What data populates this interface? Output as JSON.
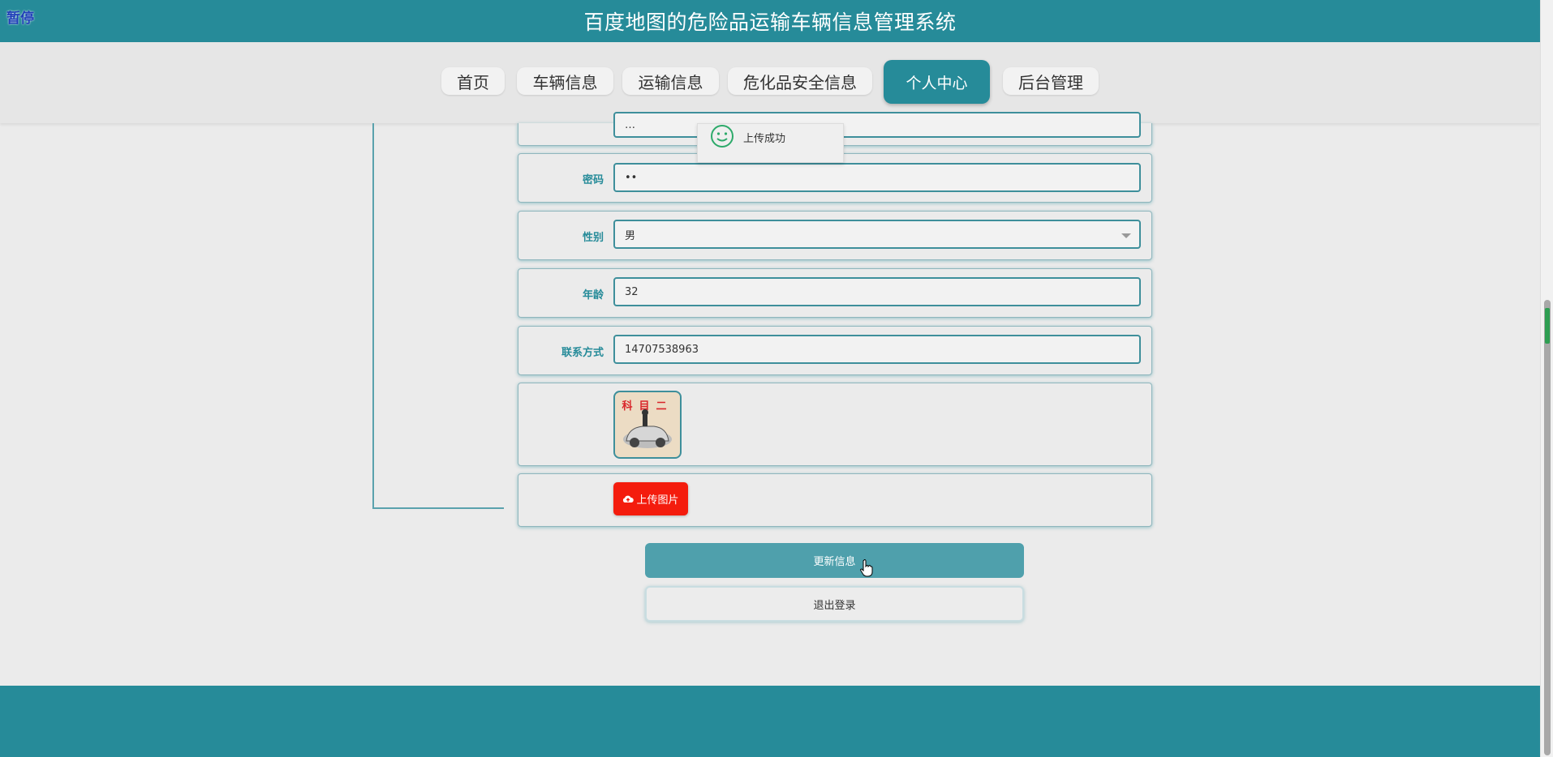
{
  "app": {
    "pause_badge": "暂停",
    "title": "百度地图的危险品运输车辆信息管理系统"
  },
  "nav": {
    "items": [
      {
        "label": "首页"
      },
      {
        "label": "车辆信息"
      },
      {
        "label": "运输信息"
      },
      {
        "label": "危化品安全信息"
      },
      {
        "label": "个人中心",
        "active": true
      },
      {
        "label": "后台管理"
      }
    ]
  },
  "toast": {
    "text": "上传成功",
    "icon": "smiley-icon"
  },
  "form": {
    "partial_value": "…",
    "password": {
      "label": "密码",
      "value": "••"
    },
    "gender": {
      "label": "性别",
      "value": "男"
    },
    "age": {
      "label": "年龄",
      "value": "32"
    },
    "phone": {
      "label": "联系方式",
      "value": "14707538963"
    },
    "avatar": {
      "caption": "科目二"
    },
    "upload": {
      "label": "上传图片",
      "icon": "cloud-upload-icon"
    }
  },
  "actions": {
    "update": "更新信息",
    "logout": "退出登录"
  },
  "colors": {
    "primary": "#268b99",
    "upload": "#f41c0d",
    "update_btn": "#4fa0ac"
  }
}
